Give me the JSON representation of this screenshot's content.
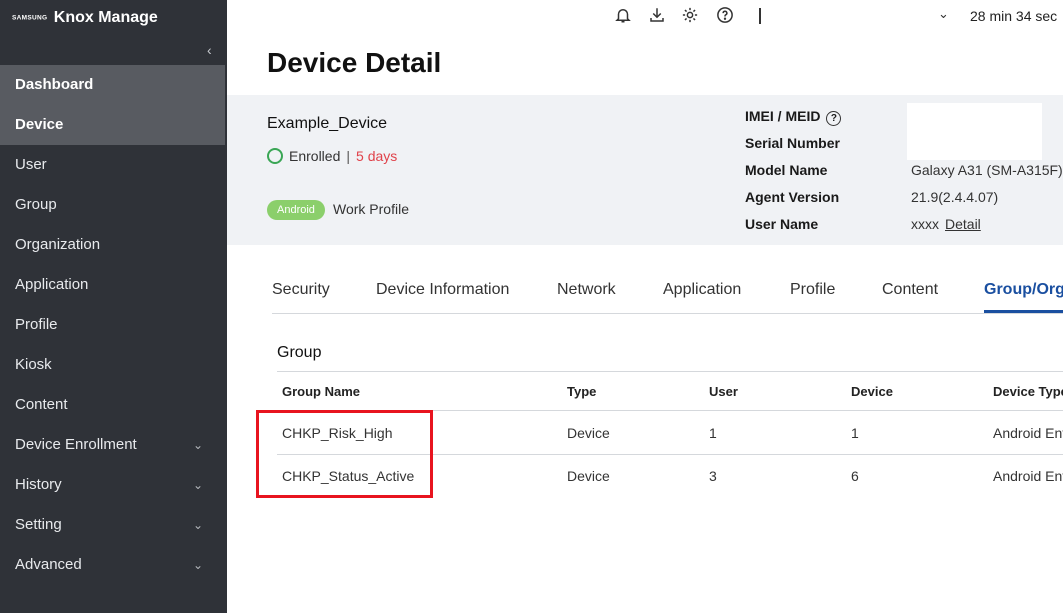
{
  "brand": {
    "samsung": "SAMSUNG",
    "product": "Knox Manage"
  },
  "sidebar": {
    "collapse_icon": "chevron-left-icon",
    "items": [
      {
        "label": "Dashboard",
        "active": true
      },
      {
        "label": "Device",
        "active": true
      },
      {
        "label": "User"
      },
      {
        "label": "Group"
      },
      {
        "label": "Organization"
      },
      {
        "label": "Application"
      },
      {
        "label": "Profile"
      },
      {
        "label": "Kiosk"
      },
      {
        "label": "Content"
      },
      {
        "label": "Device Enrollment",
        "expandable": true
      },
      {
        "label": "History",
        "expandable": true
      },
      {
        "label": "Setting",
        "expandable": true
      },
      {
        "label": "Advanced",
        "expandable": true
      }
    ],
    "chevron": "⌄"
  },
  "topbar": {
    "icons": [
      "bell-icon",
      "download-icon",
      "gear-icon",
      "help-icon"
    ],
    "session_timer": "28 min 34 sec"
  },
  "page": {
    "title": "Device Detail"
  },
  "device": {
    "name": "Example_Device",
    "status": "Enrolled",
    "status_separator": "|",
    "duration": "5 days",
    "platform_badge": "Android",
    "profile_type": "Work Profile",
    "info_labels": {
      "imei": "IMEI / MEID",
      "serial": "Serial Number",
      "model": "Model Name",
      "agent": "Agent Version",
      "user": "User Name"
    },
    "help_glyph": "?",
    "model": "Galaxy A31 (SM-A315F)",
    "agent_version": "21.9(2.4.4.07)",
    "user_name": "xxxx",
    "user_detail_link": "Detail"
  },
  "tabs": [
    {
      "label": "Security"
    },
    {
      "label": "Device Information"
    },
    {
      "label": "Network"
    },
    {
      "label": "Application"
    },
    {
      "label": "Profile"
    },
    {
      "label": "Content"
    },
    {
      "label": "Group/Orga",
      "active": true
    }
  ],
  "group_section": {
    "title": "Group",
    "columns": [
      "Group Name",
      "Type",
      "User",
      "Device",
      "Device Type"
    ],
    "rows": [
      [
        "CHKP_Risk_High",
        "Device",
        "1",
        "1",
        "Android Ent"
      ],
      [
        "CHKP_Status_Active",
        "Device",
        "3",
        "6",
        "Android Ent"
      ]
    ]
  },
  "colors": {
    "sidebar_bg": "#2f3238",
    "sidebar_active": "#585b61",
    "accent": "#1a4fa0",
    "enrolled_green": "#3aa655",
    "days_red": "#e0424a",
    "badge_green": "#8bcf6b",
    "highlight_red": "#e8141f"
  }
}
